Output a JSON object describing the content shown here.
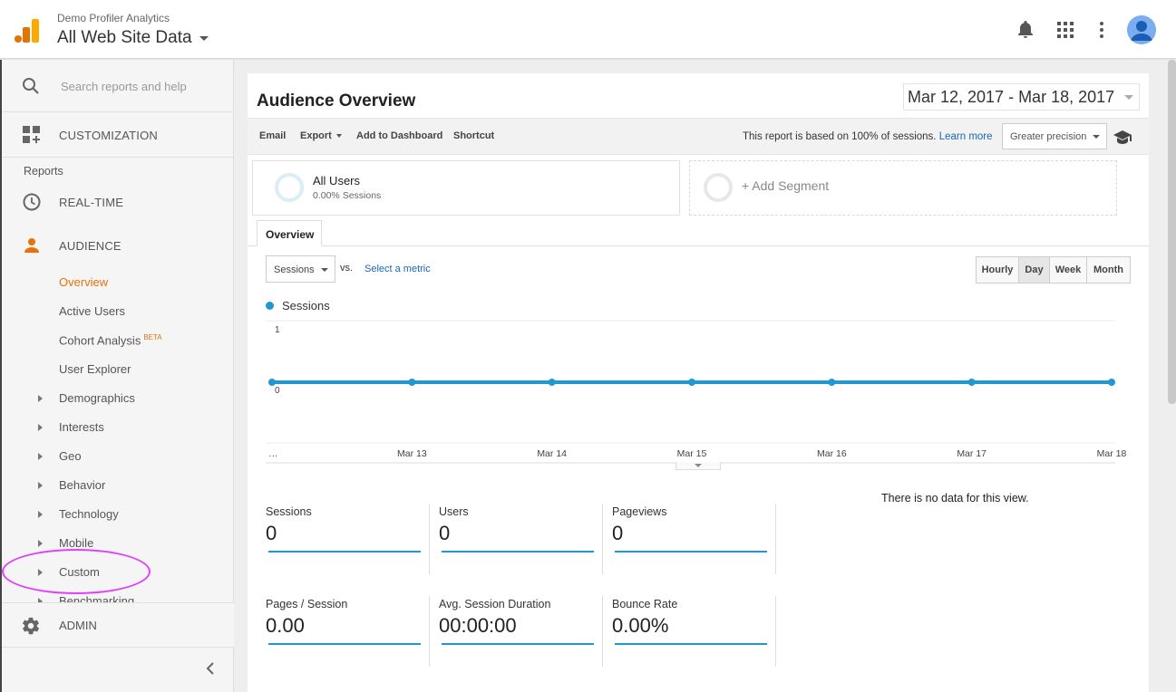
{
  "header": {
    "account_name": "Demo Profiler Analytics",
    "view_name": "All Web Site Data"
  },
  "sidebar": {
    "search_placeholder": "Search reports and help",
    "customization_label": "CUSTOMIZATION",
    "reports_label": "Reports",
    "realtime_label": "REAL-TIME",
    "audience_label": "AUDIENCE",
    "audience_items": [
      {
        "label": "Overview",
        "active": true
      },
      {
        "label": "Active Users",
        "active": false
      },
      {
        "label": "Cohort Analysis",
        "badge": "BETA",
        "active": false
      },
      {
        "label": "User Explorer",
        "active": false
      }
    ],
    "expandable_items": [
      "Demographics",
      "Interests",
      "Geo",
      "Behavior",
      "Technology",
      "Mobile",
      "Custom",
      "Benchmarking"
    ],
    "admin_label": "ADMIN"
  },
  "report": {
    "title": "Audience Overview",
    "date_range": "Mar 12, 2017 - Mar 18, 2017",
    "toolbar": {
      "email": "Email",
      "export": "Export",
      "add_to_dashboard": "Add to Dashboard",
      "shortcut": "Shortcut",
      "note": "This report is based on 100% of sessions.",
      "learn_more": "Learn more",
      "precision": "Greater precision"
    },
    "segments": {
      "all_users_name": "All Users",
      "all_users_sub": "0.00% Sessions",
      "add_segment": "+ Add Segment"
    },
    "tab_overview": "Overview",
    "metric_selector": "Sessions",
    "vs": "vs.",
    "select_metric": "Select a metric",
    "granularity": [
      "Hourly",
      "Day",
      "Week",
      "Month"
    ],
    "granularity_selected": "Day",
    "no_data": "There is no data for this view."
  },
  "chart_data": {
    "type": "line",
    "series": [
      {
        "name": "Sessions",
        "values": [
          0,
          0,
          0,
          0,
          0,
          0,
          0
        ]
      }
    ],
    "x": [
      "…",
      "Mar 13",
      "Mar 14",
      "Mar 15",
      "Mar 16",
      "Mar 17",
      "Mar 18"
    ],
    "y_ticks": [
      "1",
      "0"
    ],
    "ylim": [
      0,
      1
    ],
    "color": "#2297d0",
    "legend": "top-left"
  },
  "metrics": [
    {
      "label": "Sessions",
      "value": "0"
    },
    {
      "label": "Users",
      "value": "0"
    },
    {
      "label": "Pageviews",
      "value": "0"
    },
    {
      "label": "Pages / Session",
      "value": "0.00"
    },
    {
      "label": "Avg. Session Duration",
      "value": "00:00:00"
    },
    {
      "label": "Bounce Rate",
      "value": "0.00%"
    }
  ],
  "colors": {
    "accent_orange": "#e8710a",
    "series_blue": "#2297d0",
    "link_blue": "#1a66b3",
    "annotation_magenta": "#e040fb"
  }
}
